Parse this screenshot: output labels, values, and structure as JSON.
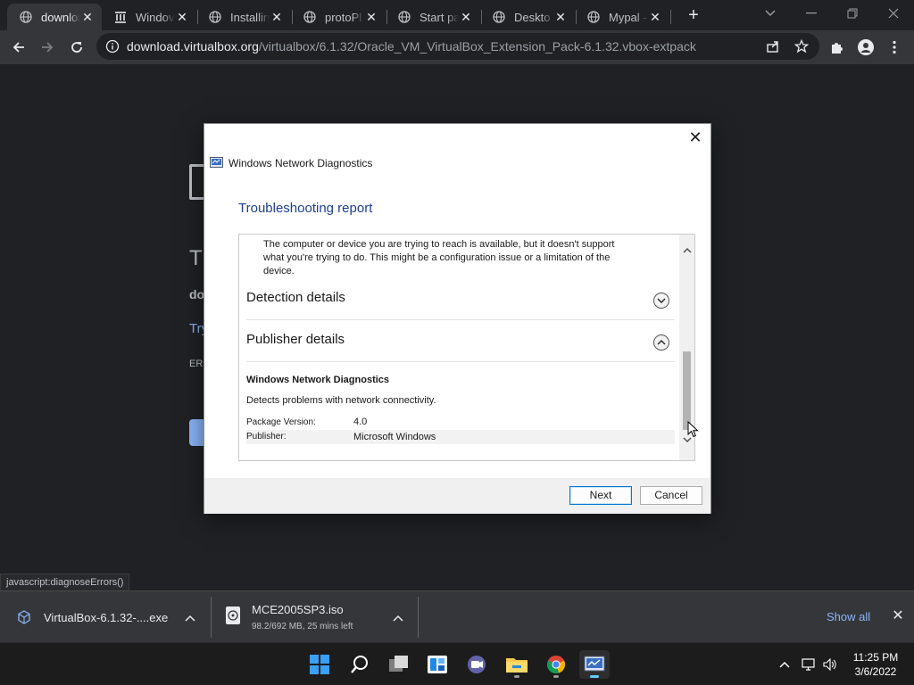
{
  "browser": {
    "tabs": [
      {
        "title": "downloa",
        "favicon": "globe-icon",
        "active": true
      },
      {
        "title": "Windov",
        "favicon": "museum-icon",
        "active": false
      },
      {
        "title": "Installin",
        "favicon": "globe-icon",
        "active": false
      },
      {
        "title": "protoPl",
        "favicon": "globe-icon",
        "active": false
      },
      {
        "title": "Start pa",
        "favicon": "globe-icon",
        "active": false
      },
      {
        "title": "Deskto",
        "favicon": "globe-icon",
        "active": false
      },
      {
        "title": "Mypal -",
        "favicon": "globe-icon",
        "active": false
      }
    ],
    "url_host": "download.virtualbox.org",
    "url_path": "/virtualbox/6.1.32/Oracle_VM_VirtualBox_Extension_Pack-6.1.32.vbox-extpack",
    "status_url": "javascript:diagnoseErrors()"
  },
  "background_page": {
    "title_fragment": "Tl",
    "host_fragment": "do",
    "link_fragment": "Try",
    "error_fragment": "ERI"
  },
  "dialog": {
    "window_title": "Windows Network Diagnostics",
    "heading": "Troubleshooting report",
    "problem_text": "The computer or device you are trying to reach is available, but it doesn't support what you're trying to do. This might be a configuration issue or a limitation of the device.",
    "sections": [
      {
        "title": "Detection details",
        "state": "collapsed"
      },
      {
        "title": "Publisher details",
        "state": "expanded"
      }
    ],
    "publisher": {
      "name": "Windows Network Diagnostics",
      "description": "Detects problems with network connectivity.",
      "version_label": "Package Version:",
      "version_value": "4.0",
      "publisher_label": "Publisher:",
      "publisher_value": "Microsoft Windows"
    },
    "buttons": {
      "next": "Next",
      "cancel": "Cancel"
    }
  },
  "downloads": {
    "items": [
      {
        "name": "VirtualBox-6.1.32-....exe",
        "status": "",
        "icon": "virtualbox-icon"
      },
      {
        "name": "MCE2005SP3.iso",
        "status": "98.2/692 MB, 25 mins left",
        "icon": "iso-file-icon"
      }
    ],
    "show_all": "Show all"
  },
  "taskbar": {
    "time": "11:25 PM",
    "date": "3/6/2022",
    "apps": [
      "start-icon",
      "search-icon",
      "task-view-icon",
      "widgets-icon",
      "chat-icon",
      "file-explorer-icon",
      "chrome-icon",
      "network-diagnostics-icon"
    ]
  },
  "colors": {
    "heading_blue": "#1c3f94",
    "link_blue": "#8ab4f8",
    "default_button_border": "#0078d7"
  }
}
